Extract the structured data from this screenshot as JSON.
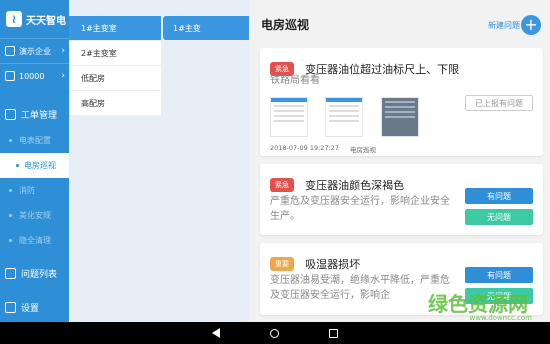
{
  "app": {
    "name": "天天智电",
    "logo_glyph": "•"
  },
  "nav": {
    "account": "演示企业",
    "number": "10000",
    "sections": [
      {
        "label": "工单管理",
        "items": [
          "电表配置",
          "电房巡视",
          "消防",
          "美化安规",
          "隐全清理"
        ]
      },
      {
        "label": "问题列表"
      },
      {
        "label": "设置"
      }
    ],
    "active": "电房巡视"
  },
  "col1": [
    "1#主变室",
    "2#主变室",
    "低配房",
    "高配房"
  ],
  "col2": [
    "1#主变"
  ],
  "main": {
    "title": "电房巡视",
    "new_label": "新建问题",
    "plus": "+"
  },
  "cards": [
    {
      "tag": "紧急",
      "title": "变压器油位超过油标尺上、下限",
      "desc": "铁路局看看",
      "timestamp": "2018-07-09 19:27:27",
      "category": "电房巡视",
      "button": "已上报有问题"
    },
    {
      "tag": "紧急",
      "title": "变压器油颜色深褐色",
      "desc": "严重危及变压器安全运行，影响企业安全生产。",
      "buttons": [
        "有问题",
        "无问题"
      ]
    },
    {
      "tag": "重要",
      "title": "吸湿器损坏",
      "desc": "变压器油易受潮，绝缘水平降低，严重危及变压器安全运行，影响企",
      "buttons": [
        "有问题",
        "无问题"
      ]
    }
  ],
  "watermark": {
    "text": "绿色资源网",
    "url": "www.downcc.com"
  },
  "colors": {
    "primary": "#2f8fd6",
    "urgent": "#e2514c",
    "important": "#f0a64a",
    "green": "#3ec9a5"
  }
}
